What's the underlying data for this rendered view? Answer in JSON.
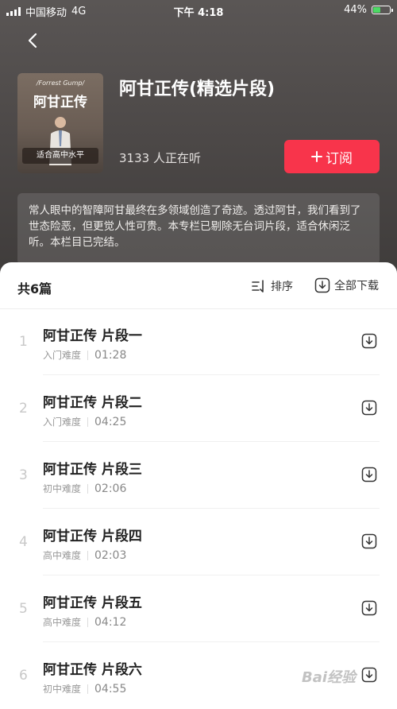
{
  "status_bar": {
    "carrier": "中国移动",
    "network": "4G",
    "time": "下午 4:18",
    "battery": "44%"
  },
  "album": {
    "cover_subtitle": "/Forrest Gump/",
    "cover_title": "阿甘正传",
    "cover_tag": "适合高中水平",
    "title": "阿甘正传(精选片段)",
    "listeners": "3133 人正在听",
    "subscribe_label": "订阅",
    "description": "常人眼中的智障阿甘最终在多领域创造了奇迹。透过阿甘，我们看到了世态险恶，但更觉人性可贵。本专栏已剔除无台词片段，适合休闲泛听。本栏目已完结。"
  },
  "list": {
    "count_label": "共6篇",
    "sort_label": "排序",
    "download_all_label": "全部下载",
    "episodes": [
      {
        "index": "1",
        "title": "阿甘正传 片段一",
        "level": "入门难度",
        "duration": "01:28"
      },
      {
        "index": "2",
        "title": "阿甘正传 片段二",
        "level": "入门难度",
        "duration": "04:25"
      },
      {
        "index": "3",
        "title": "阿甘正传 片段三",
        "level": "初中难度",
        "duration": "02:06"
      },
      {
        "index": "4",
        "title": "阿甘正传 片段四",
        "level": "高中难度",
        "duration": "02:03"
      },
      {
        "index": "5",
        "title": "阿甘正传 片段五",
        "level": "高中难度",
        "duration": "04:12"
      },
      {
        "index": "6",
        "title": "阿甘正传 片段六",
        "level": "初中难度",
        "duration": "04:55"
      }
    ]
  },
  "watermark": "Bai经验",
  "colors": {
    "accent": "#f8344b",
    "header_bg": "#4d4948"
  },
  "icons": [
    "back-arrow-icon",
    "plus-icon",
    "sort-icon",
    "download-icon"
  ]
}
